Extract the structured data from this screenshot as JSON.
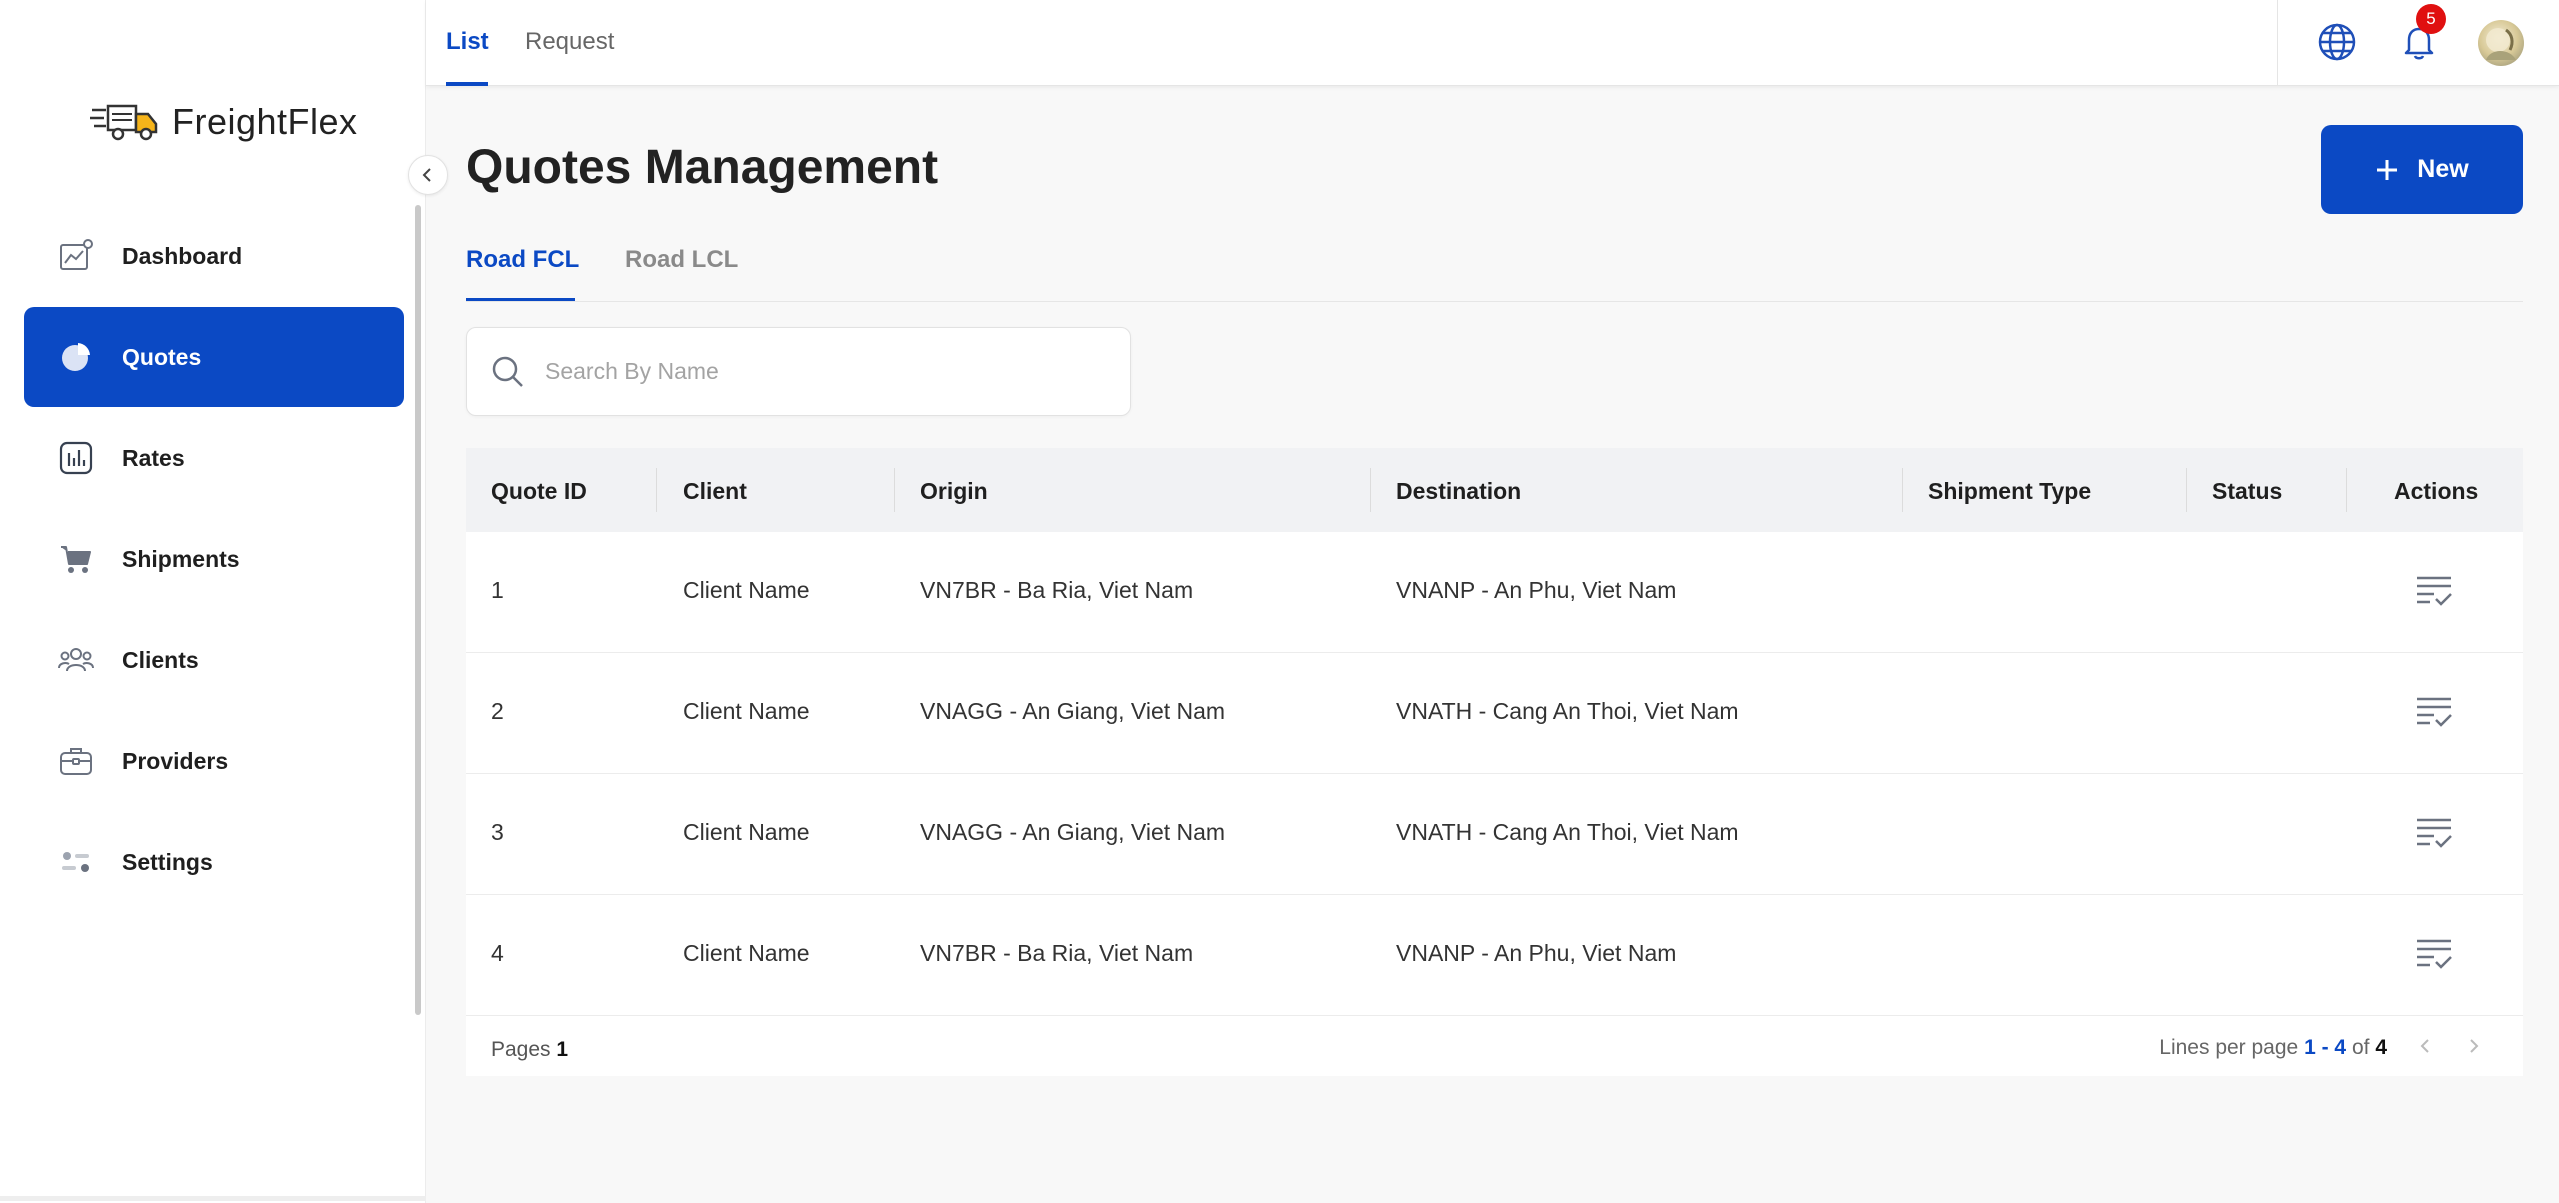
{
  "app": {
    "name": "FreightFlex"
  },
  "topbar": {
    "tabs": [
      {
        "label": "List",
        "active": true
      },
      {
        "label": "Request",
        "active": false
      }
    ],
    "notifications_count": "5",
    "icons": [
      "globe-icon",
      "bell-icon",
      "avatar"
    ]
  },
  "sidebar": {
    "items": [
      {
        "label": "Dashboard",
        "icon": "chart-icon",
        "active": false
      },
      {
        "label": "Quotes",
        "icon": "pie-chart-icon",
        "active": true
      },
      {
        "label": "Rates",
        "icon": "bar-chart-icon",
        "active": false
      },
      {
        "label": "Shipments",
        "icon": "cart-icon",
        "active": false
      },
      {
        "label": "Clients",
        "icon": "users-icon",
        "active": false
      },
      {
        "label": "Providers",
        "icon": "briefcase-icon",
        "active": false
      },
      {
        "label": "Settings",
        "icon": "settings-icon",
        "active": false
      }
    ]
  },
  "main": {
    "title": "Quotes Management",
    "new_button": "New",
    "subtabs": [
      {
        "label": "Road FCL",
        "active": true
      },
      {
        "label": "Road LCL",
        "active": false
      }
    ],
    "search": {
      "placeholder": "Search By Name",
      "value": ""
    },
    "table": {
      "columns": [
        "Quote ID",
        "Client",
        "Origin",
        "Destination",
        "Shipment Type",
        "Status",
        "Actions"
      ],
      "rows": [
        {
          "id": "1",
          "client": "Client Name",
          "origin": "VN7BR - Ba Ria, Viet Nam",
          "destination": "VNANP - An Phu, Viet Nam",
          "shipment_type": "",
          "status": ""
        },
        {
          "id": "2",
          "client": "Client Name",
          "origin": "VNAGG - An Giang, Viet Nam",
          "destination": "VNATH - Cang An Thoi, Viet Nam",
          "shipment_type": "",
          "status": ""
        },
        {
          "id": "3",
          "client": "Client Name",
          "origin": "VNAGG - An Giang, Viet Nam",
          "destination": "VNATH - Cang An Thoi, Viet Nam",
          "shipment_type": "",
          "status": ""
        },
        {
          "id": "4",
          "client": "Client Name",
          "origin": "VN7BR - Ba Ria, Viet Nam",
          "destination": "VNANP - An Phu, Viet Nam",
          "shipment_type": "",
          "status": ""
        }
      ]
    },
    "pagination": {
      "pages_label": "Pages",
      "pages_value": "1",
      "lines_label": "Lines per page",
      "range": "1 - 4",
      "of_label": "of",
      "total": "4"
    }
  },
  "colors": {
    "primary": "#0b49c4",
    "badge": "#e01010",
    "icon_gray": "#6b7280"
  }
}
